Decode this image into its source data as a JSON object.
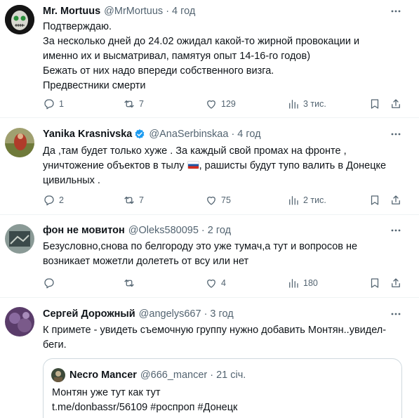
{
  "tweets": [
    {
      "name": "Mr. Mortuus",
      "handle": "@MrMortuus",
      "time": "4 год",
      "lines": [
        "Подтверждаю.",
        "За несколько дней до 24.02 ожидал какой-то жирной провокации и",
        "именно их и высматривал, памятуя опыт 14-16-го годов)",
        "Бежать от них надо впереди собственного визга.",
        "Предвестники смерти"
      ],
      "replies": "1",
      "retweets": "7",
      "likes": "129",
      "views": "3 тис."
    },
    {
      "name": "Yanika Krasnivska",
      "handle": "@AnaSerbinskaa",
      "time": "4 год",
      "verified": true,
      "lines": [
        "Да ,там будет только хуже . За каждый свой промах на фронте ,",
        "уничтожение объектов в тылу",
        ", рашисты будут тупо валить в Донецке",
        "цивильных ."
      ],
      "replies": "2",
      "retweets": "7",
      "likes": "75",
      "views": "2 тис."
    },
    {
      "name": "фон не мовитон",
      "handle": "@Oleks580095",
      "time": "2 год",
      "lines": [
        "Безусловно,снова по белгороду это уже тумач,а тут и вопросов не",
        "возникает можетли долететь от всу или нет"
      ],
      "replies": "",
      "retweets": "",
      "likes": "4",
      "views": "180"
    },
    {
      "name": "Сергей Дорожный",
      "handle": "@angelys667",
      "time": "3 год",
      "lines": [
        "К примете - увидеть съемочную группу нужно добавить Монтян..увидел-",
        "беги."
      ]
    }
  ],
  "quote": {
    "name": "Necro Mancer",
    "handle": "@666_mancer",
    "time": "21 січ.",
    "lines": [
      "Монтян уже тут как тут",
      "t.me/donbassr/56109 #роспроп #Донецк"
    ]
  },
  "separator": "·",
  "icons": [
    "more-icon",
    "reply-icon",
    "retweet-icon",
    "like-icon",
    "views-icon",
    "bookmark-icon",
    "share-icon",
    "verified-icon",
    "flag-ru-icon"
  ],
  "colors": {
    "text": "#0f1419",
    "secondary": "#536471",
    "verified": "#1d9bf0",
    "border": "#eff3f4"
  }
}
